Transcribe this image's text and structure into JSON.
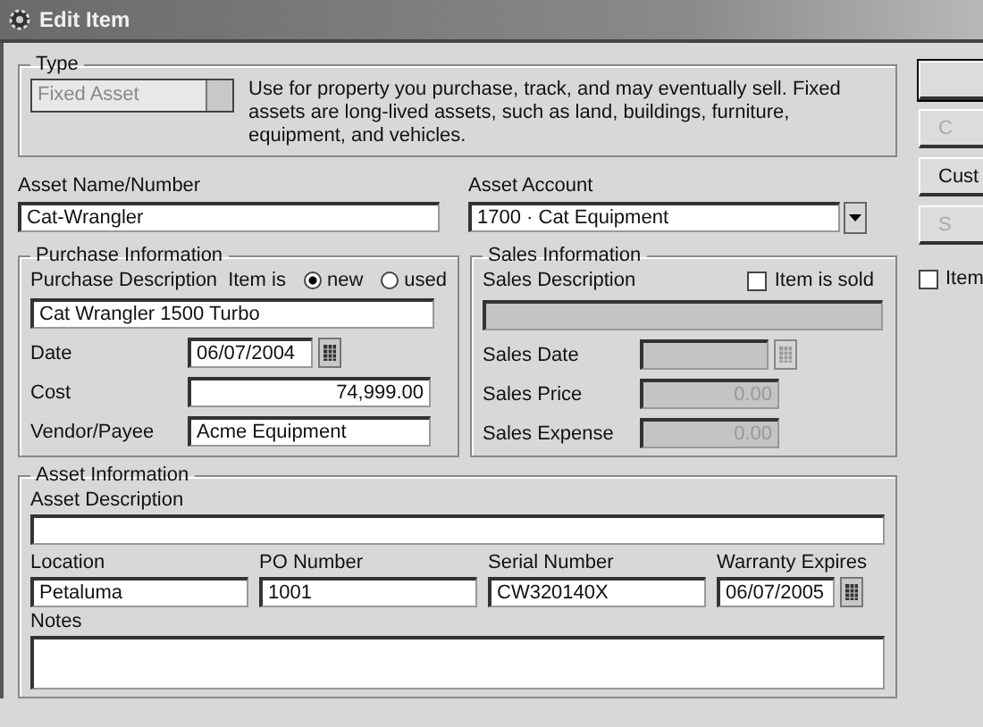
{
  "window": {
    "title": "Edit Item"
  },
  "type": {
    "label": "Type",
    "value": "Fixed Asset",
    "description": "Use for property you purchase, track, and may eventually sell.  Fixed assets are long-lived assets, such as land, buildings, furniture, equipment, and vehicles."
  },
  "asset_name": {
    "label": "Asset Name/Number",
    "value": "Cat-Wrangler"
  },
  "asset_account": {
    "label": "Asset Account",
    "value": "1700 · Cat Equipment"
  },
  "purchase": {
    "title": "Purchase Information",
    "description_label": "Purchase Description",
    "item_is_label": "Item is",
    "conditions": [
      {
        "label": "new",
        "selected": true
      },
      {
        "label": "used",
        "selected": false
      }
    ],
    "description": "Cat Wrangler 1500 Turbo",
    "fields": [
      {
        "label": "Date",
        "value": "06/07/2004",
        "kind": "date",
        "disabled": false
      },
      {
        "label": "Cost",
        "value": "74,999.00",
        "kind": "amount",
        "disabled": false
      },
      {
        "label": "Vendor/Payee",
        "value": "Acme Equipment",
        "kind": "text",
        "disabled": false
      }
    ]
  },
  "sales": {
    "title": "Sales Information",
    "description_label": "Sales Description",
    "sold": {
      "label": "Item is sold",
      "checked": false
    },
    "description_disabled": true,
    "fields": [
      {
        "label": "Sales Date",
        "kind": "date",
        "disabled": true
      },
      {
        "label": "Sales Price",
        "value": "0.00",
        "kind": "amount",
        "disabled": true
      },
      {
        "label": "Sales Expense",
        "value": "0.00",
        "kind": "amount",
        "disabled": true
      }
    ]
  },
  "asset_info": {
    "title": "Asset Information",
    "description_label": "Asset Description",
    "notes_label": "Notes",
    "fields": [
      {
        "label": "Location",
        "value": "Petaluma",
        "kind": "text"
      },
      {
        "label": "PO Number",
        "value": "1001",
        "kind": "text"
      },
      {
        "label": "Serial Number",
        "value": "CW320140X",
        "kind": "text"
      },
      {
        "label": "Warranty Expires",
        "value": "06/07/2005",
        "kind": "date"
      }
    ]
  },
  "side_buttons": [
    {
      "default": true,
      "disabled": false
    },
    {
      "label": "C",
      "default": false,
      "disabled": true
    },
    {
      "label": "Cust",
      "default": false,
      "disabled": false
    },
    {
      "label": "S",
      "default": false,
      "disabled": true
    }
  ],
  "side_checkbox": {
    "label": "Item",
    "checked": false
  }
}
